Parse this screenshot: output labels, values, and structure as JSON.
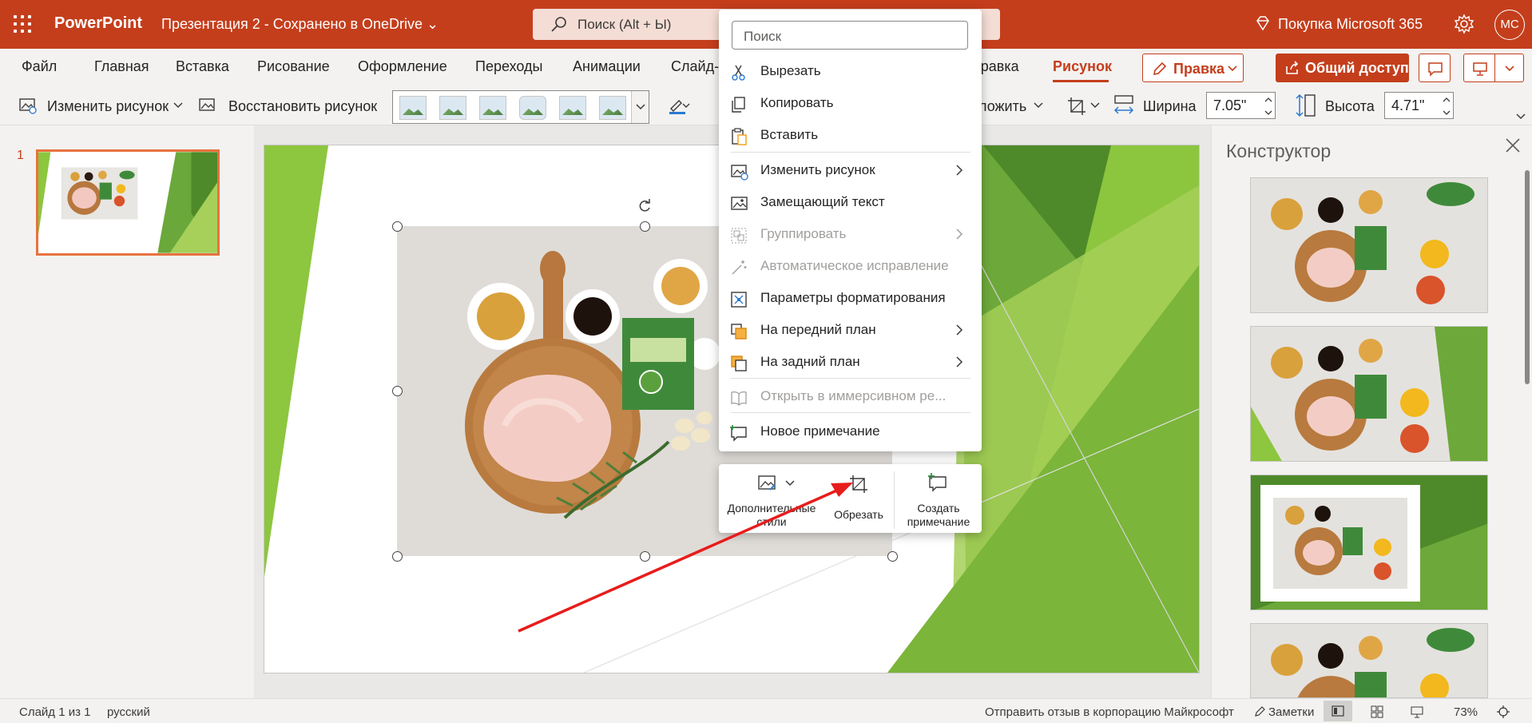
{
  "titlebar": {
    "app_name": "PowerPoint",
    "doc_title": "Презентация 2 - Сохранено в OneDrive ⌄",
    "search_placeholder": "Поиск (Alt + Ы)",
    "premium": "Покупка Microsoft 365",
    "avatar": "МС",
    "brand_color": "#c43e1c"
  },
  "tabs": [
    "Файл",
    "Главная",
    "Вставка",
    "Рисование",
    "Оформление",
    "Переходы",
    "Анимации",
    "Слайд-ш",
    "правка",
    "Рисунок"
  ],
  "active_tab": "Рисунок",
  "actions": {
    "edit": "Правка",
    "share": "Общий доступ"
  },
  "ribbon": {
    "change_picture": "Изменить рисунок",
    "reset_picture": "Восстановить рисунок",
    "arrange": "ложить",
    "width_label": "Ширина",
    "width_value": "7.05\"",
    "height_label": "Высота",
    "height_value": "4.71\""
  },
  "thumbnails": {
    "slide_number": "1"
  },
  "designer": {
    "title": "Конструктор"
  },
  "context_menu": {
    "search_placeholder": "Поиск",
    "items": [
      {
        "label": "Вырезать",
        "icon": "scissors-icon",
        "enabled": true,
        "submenu": false
      },
      {
        "label": "Копировать",
        "icon": "copy-icon",
        "enabled": true,
        "submenu": false
      },
      {
        "label": "Вставить",
        "icon": "paste-icon",
        "enabled": true,
        "submenu": false
      },
      {
        "label": "Изменить рисунок",
        "icon": "change-picture-icon",
        "enabled": true,
        "submenu": true
      },
      {
        "label": "Замещающий текст",
        "icon": "alt-text-icon",
        "enabled": true,
        "submenu": false
      },
      {
        "label": "Группировать",
        "icon": "group-icon",
        "enabled": false,
        "submenu": true
      },
      {
        "label": "Автоматическое исправление",
        "icon": "auto-fix-icon",
        "enabled": false,
        "submenu": false
      },
      {
        "label": "Параметры форматирования",
        "icon": "format-options-icon",
        "enabled": true,
        "submenu": false
      },
      {
        "label": "На передний план",
        "icon": "bring-forward-icon",
        "enabled": true,
        "submenu": true
      },
      {
        "label": "На задний план",
        "icon": "send-backward-icon",
        "enabled": true,
        "submenu": true
      },
      {
        "label": "Открыть в иммерсивном ре...",
        "icon": "immersive-reader-icon",
        "enabled": false,
        "submenu": false
      },
      {
        "label": "Новое примечание",
        "icon": "new-comment-icon",
        "enabled": true,
        "submenu": false
      }
    ]
  },
  "mini_toolbar": {
    "styles_line1": "Дополнительные",
    "styles_line2": "стили",
    "crop": "Обрезать",
    "comment_line1": "Создать",
    "comment_line2": "примечание"
  },
  "statusbar": {
    "slide_info": "Слайд 1 из 1",
    "language": "русский",
    "feedback": "Отправить отзыв в корпорацию Майкрософт",
    "notes": "Заметки",
    "zoom": "73%"
  }
}
